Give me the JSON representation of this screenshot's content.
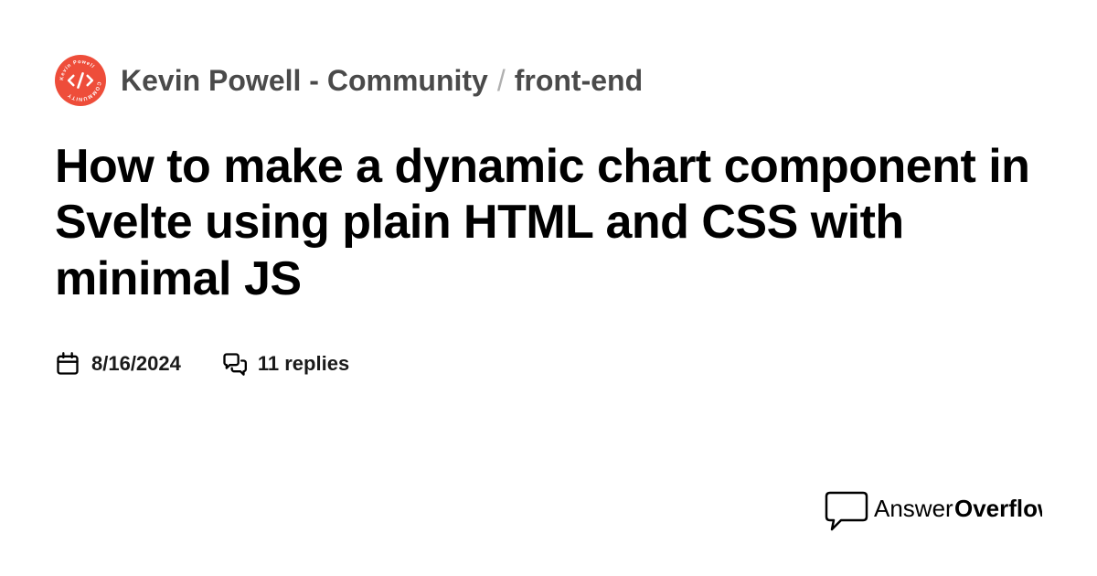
{
  "breadcrumb": {
    "community": "Kevin Powell - Community",
    "channel": "front-end",
    "separator": "/"
  },
  "title": "How to make a dynamic chart component in Svelte using plain HTML and CSS with minimal JS",
  "meta": {
    "date": "8/16/2024",
    "replies": "11 replies"
  },
  "logo": {
    "text_left": "Answer",
    "text_right": "Overflow"
  },
  "colors": {
    "badge_bg": "#ee4d3a",
    "text_primary": "#000000",
    "text_secondary": "#4a4a4a",
    "separator": "#b0b0b0"
  }
}
